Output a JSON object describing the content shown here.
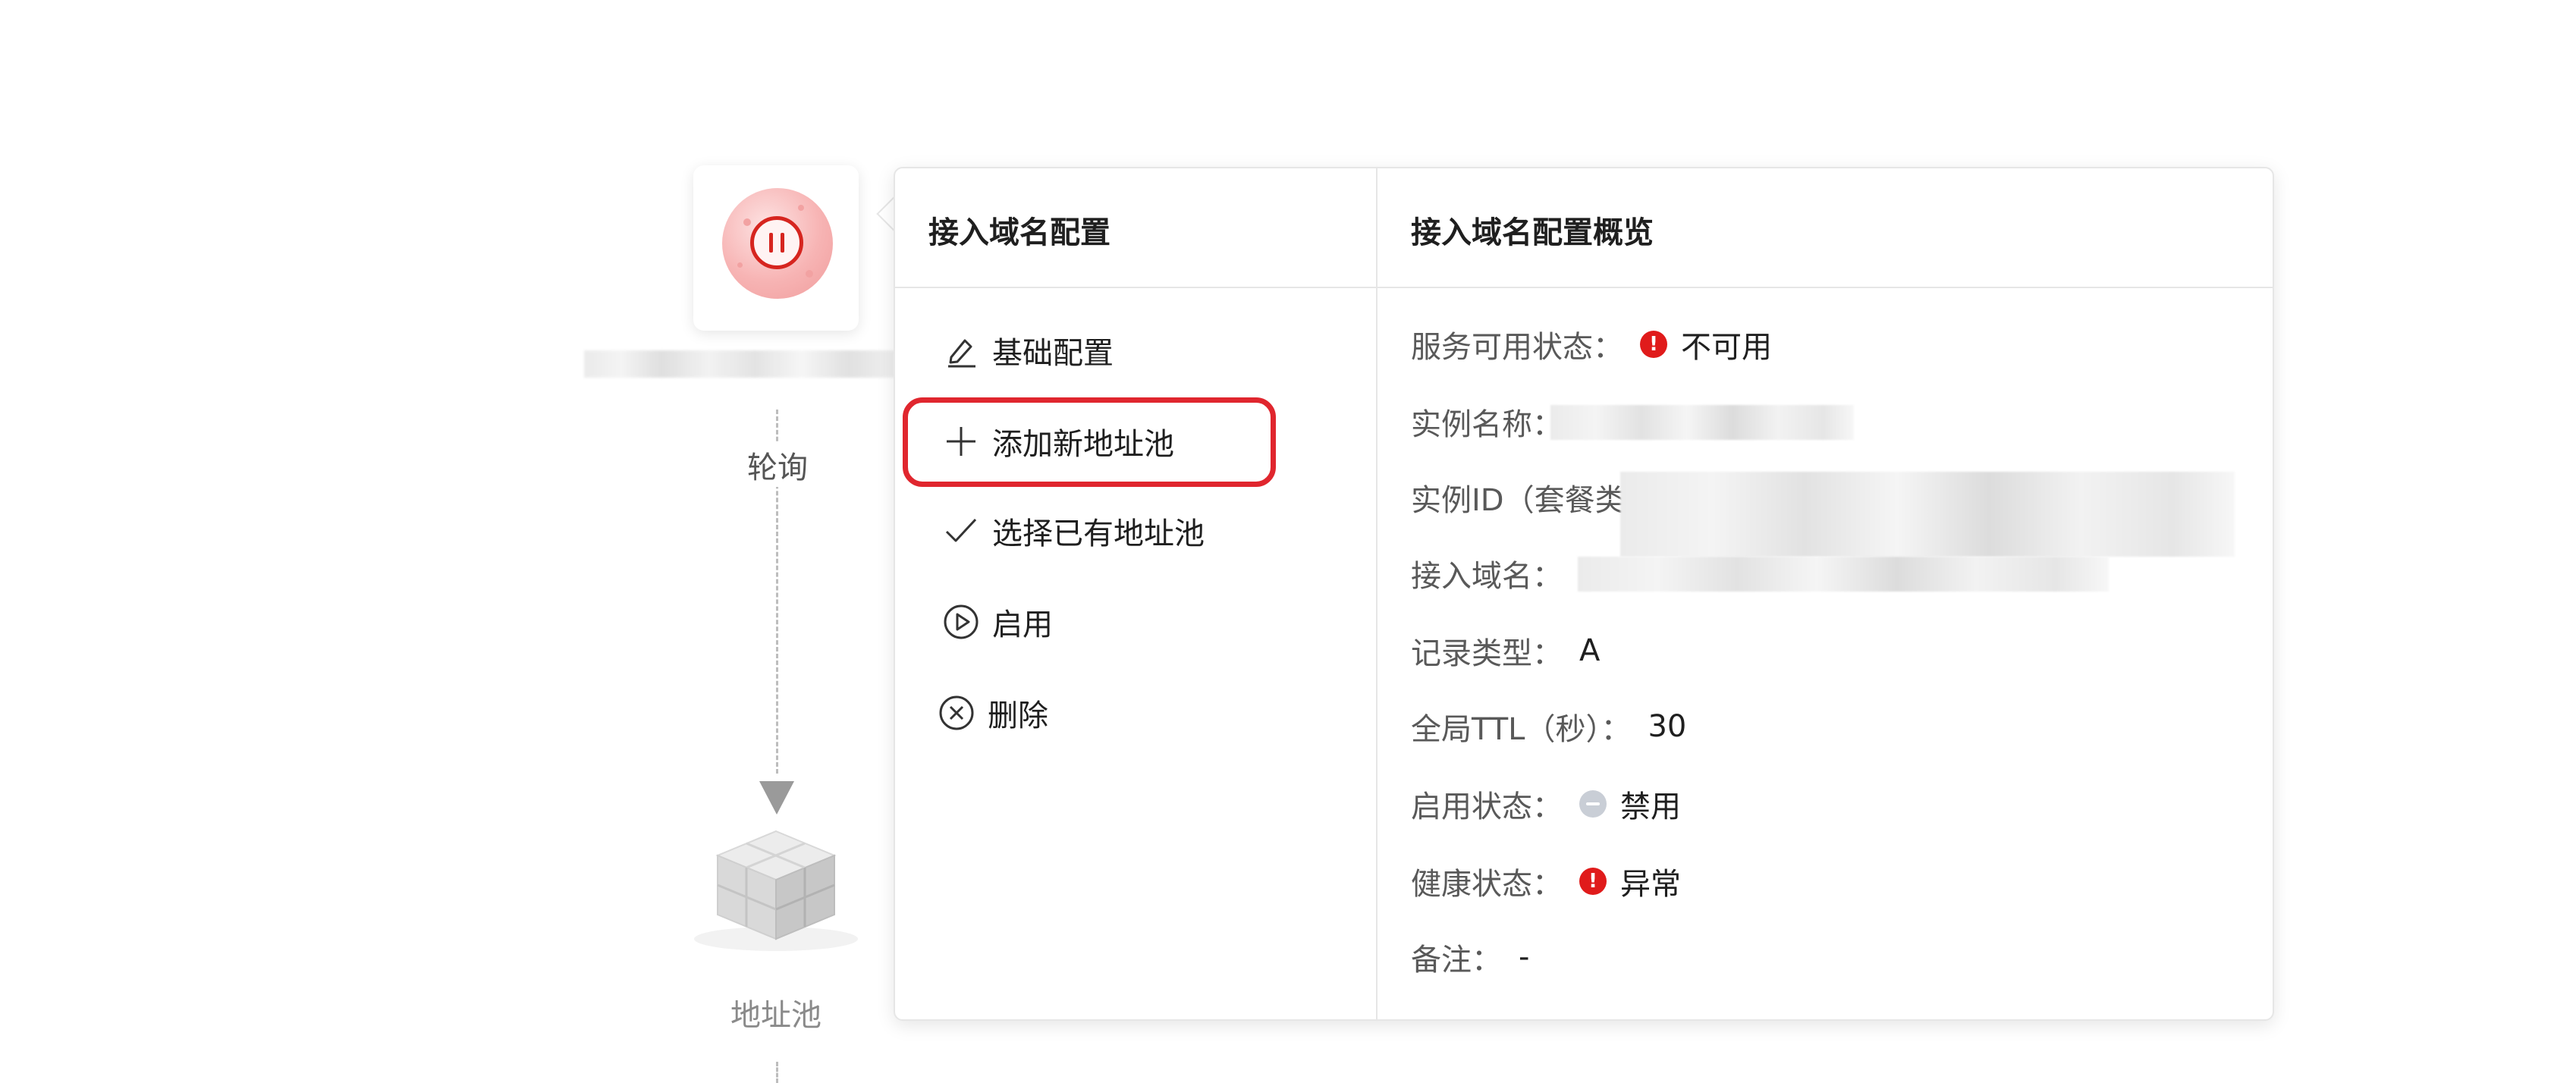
{
  "flow": {
    "edge_label": "轮询",
    "pool_label": "地址池"
  },
  "panel": {
    "menu_title": "接入域名配置",
    "overview_title": "接入域名配置概览",
    "menu": [
      {
        "label": "基础配置",
        "icon": "edit-icon"
      },
      {
        "label": "添加新地址池",
        "icon": "plus-icon",
        "highlighted": true
      },
      {
        "label": "选择已有地址池",
        "icon": "check-icon"
      },
      {
        "label": "启用",
        "icon": "play-circle-icon"
      },
      {
        "label": "删除",
        "icon": "close-circle-icon"
      }
    ],
    "overview": {
      "service_status": {
        "label": "服务可用状态：",
        "value": "不可用",
        "icon": "error-icon"
      },
      "instance_name": {
        "label": "实例名称：",
        "value": "na"
      },
      "instance_id": {
        "label": "实例ID（套餐类"
      },
      "access_domain": {
        "label": "接入域名："
      },
      "record_type": {
        "label": "记录类型：",
        "value": "A"
      },
      "global_ttl": {
        "label": "全局TTL（秒）：",
        "value": "30"
      },
      "enable_status": {
        "label": "启用状态：",
        "value": "禁用",
        "icon": "disabled-icon"
      },
      "health_status": {
        "label": "健康状态：",
        "value": "异常",
        "icon": "error-icon"
      },
      "remark": {
        "label": "备注：",
        "value": "-"
      }
    }
  },
  "colors": {
    "accent_red": "#e0262e",
    "error_red": "#e01b1b",
    "disabled_gray": "#c9ced6"
  }
}
